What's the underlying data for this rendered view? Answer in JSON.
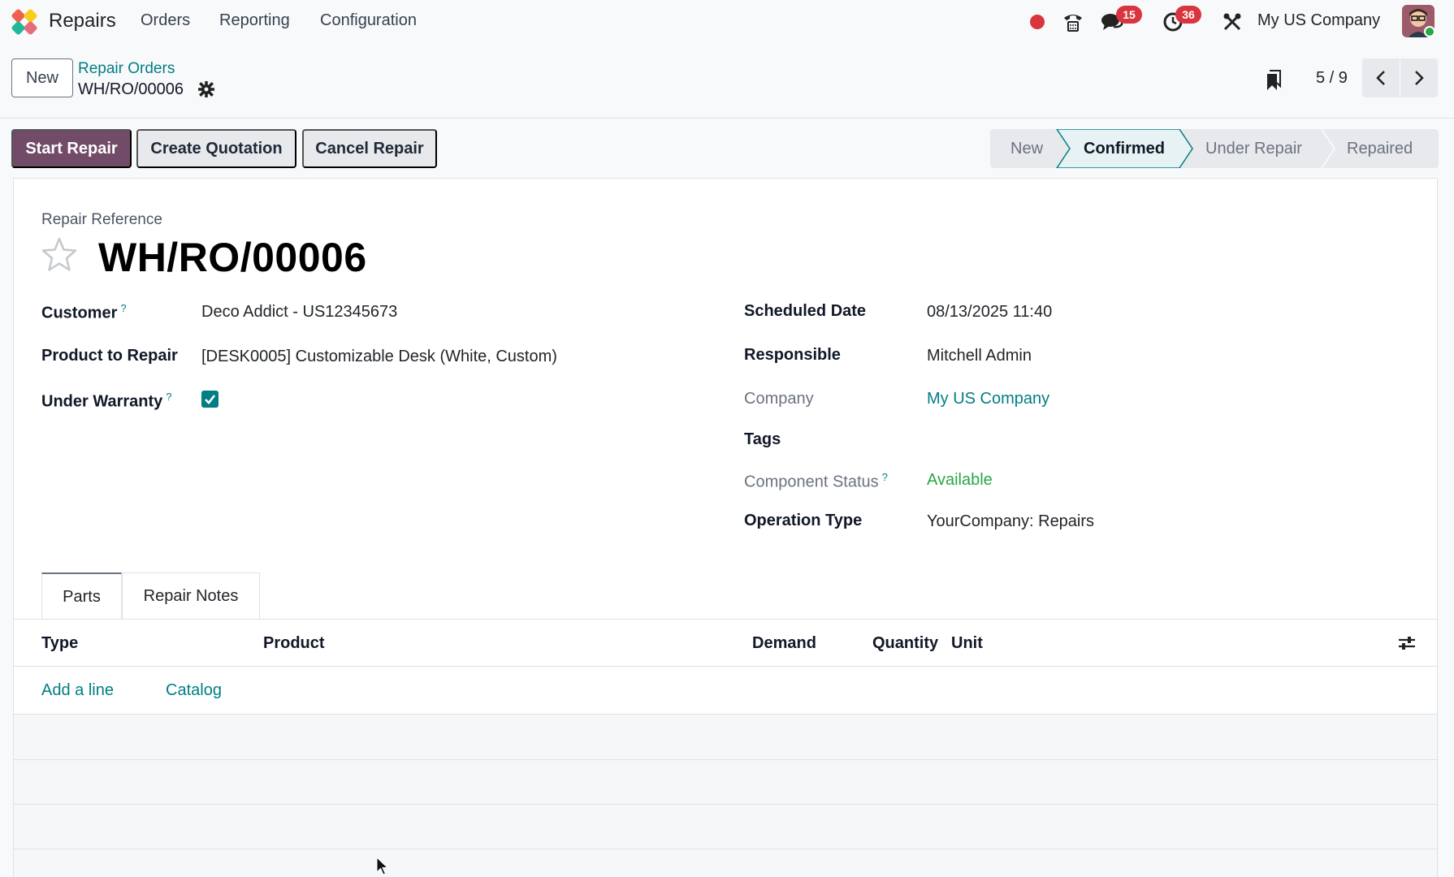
{
  "navbar": {
    "app_name": "Repairs",
    "menu": [
      "Orders",
      "Reporting",
      "Configuration"
    ],
    "messages_count": "15",
    "activities_count": "36",
    "company": "My US Company"
  },
  "control_panel": {
    "new_label": "New",
    "breadcrumb_parent": "Repair Orders",
    "breadcrumb_current": "WH/RO/00006",
    "pager": "5 / 9"
  },
  "actions": {
    "start_repair": "Start Repair",
    "create_quotation": "Create Quotation",
    "cancel_repair": "Cancel Repair"
  },
  "statusbar": {
    "stages": [
      "New",
      "Confirmed",
      "Under Repair",
      "Repaired"
    ],
    "active": "Confirmed"
  },
  "form": {
    "reference_label": "Repair Reference",
    "reference": "WH/RO/00006",
    "left": {
      "customer_label": "Customer",
      "customer": "Deco Addict - US12345673",
      "product_label": "Product to Repair",
      "product": "[DESK0005] Customizable Desk (White, Custom)",
      "warranty_label": "Under Warranty",
      "warranty": true
    },
    "right": {
      "scheduled_label": "Scheduled Date",
      "scheduled": "08/13/2025 11:40",
      "responsible_label": "Responsible",
      "responsible": "Mitchell Admin",
      "company_label": "Company",
      "company": "My US Company",
      "tags_label": "Tags",
      "component_status_label": "Component Status",
      "component_status": "Available",
      "operation_type_label": "Operation Type",
      "operation_type": "YourCompany: Repairs"
    },
    "help_mark": "?"
  },
  "tabs": [
    "Parts",
    "Repair Notes"
  ],
  "table": {
    "columns": [
      "Type",
      "Product",
      "Demand",
      "Quantity",
      "Unit"
    ],
    "add_line": "Add a line",
    "catalog": "Catalog"
  },
  "colors": {
    "primary": "#714b67",
    "link": "#017e84",
    "badge": "#d9353f",
    "success": "#28a745"
  }
}
